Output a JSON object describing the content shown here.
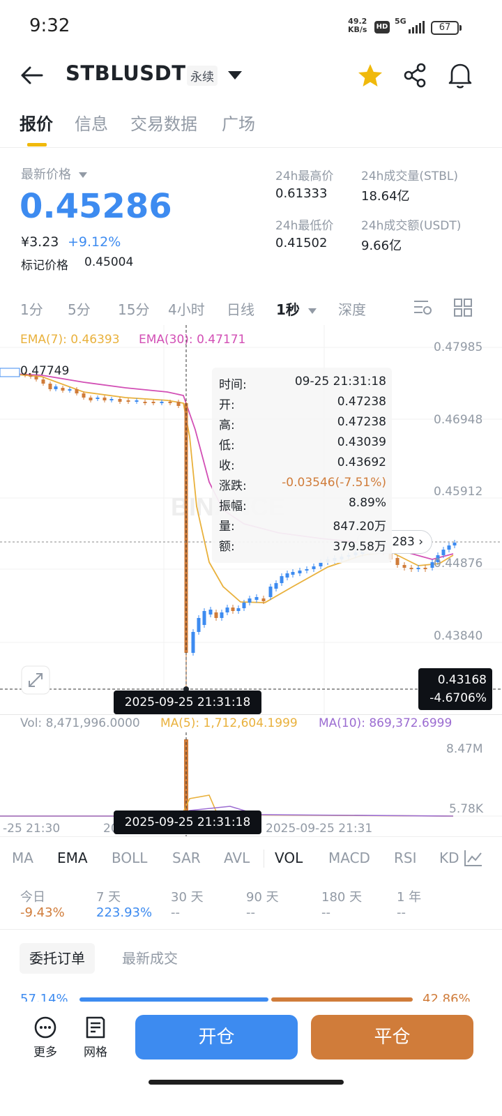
{
  "status_bar": {
    "time": "9:32",
    "speed_value": "49.2",
    "speed_unit": "KB/s",
    "hd": "HD",
    "network": "5G",
    "battery": "67"
  },
  "header": {
    "symbol": "STBLUSDT",
    "badge": "永续",
    "icons": [
      "back-arrow-icon",
      "dropdown-caret-icon",
      "star-icon",
      "share-icon",
      "bell-icon"
    ],
    "star_color": "#f0b90b"
  },
  "tabs": [
    "报价",
    "信息",
    "交易数据",
    "广场"
  ],
  "price": {
    "label": "最新价格",
    "last": "0.45286",
    "cny": "¥3.23",
    "change_pct": "+9.12%",
    "mark_label": "标记价格",
    "mark_value": "0.45004"
  },
  "stats": [
    {
      "label": "24h最高价",
      "value": "0.61333"
    },
    {
      "label": "24h成交量(STBL)",
      "value": "18.64亿"
    },
    {
      "label": "24h最低价",
      "value": "0.41502"
    },
    {
      "label": "24h成交额(USDT)",
      "value": "9.66亿"
    }
  ],
  "intervals": [
    "1分",
    "5分",
    "15分",
    "4小时",
    "日线",
    "1秒",
    "深度"
  ],
  "active_interval": "1秒",
  "chart": {
    "ema7": "EMA(7): 0.46393",
    "ema30": "EMA(30): 0.47171",
    "y_labels": [
      "0.47985",
      "0.46948",
      "0.45912",
      "0.44876",
      "0.43840"
    ],
    "first_price_label": "0.47749",
    "last_price_pill": "283",
    "cross_price": "0.43168",
    "cross_pct": "-4.6706%",
    "cross_time": "2025-09-25 21:31:18",
    "watermark": "BINANCE",
    "colors": {
      "up": "#3d8bf0",
      "down": "#d07c3a",
      "ema7": "#e9b13c",
      "ema30": "#d24fb5",
      "ma10": "#9b6cd1"
    }
  },
  "tooltip": {
    "rows": [
      {
        "k": "时间:",
        "v": "09-25 21:31:18"
      },
      {
        "k": "开:",
        "v": "0.47238"
      },
      {
        "k": "高:",
        "v": "0.47238"
      },
      {
        "k": "低:",
        "v": "0.43039"
      },
      {
        "k": "收:",
        "v": "0.43692"
      },
      {
        "k": "涨跌:",
        "v": "-0.03546(-7.51%)"
      },
      {
        "k": "振幅:",
        "v": "8.89%"
      },
      {
        "k": "量:",
        "v": "847.20万"
      },
      {
        "k": "额:",
        "v": "379.58万"
      }
    ]
  },
  "volume": {
    "vol": "Vol: 8,471,996.0000",
    "ma5": "MA(5): 1,712,604.1999",
    "ma10": "MA(10): 869,372.6999",
    "y_labels": [
      "8.47M",
      "5.78K"
    ],
    "x_labels": [
      "-25 21:30",
      "20",
      "2025-09-25 21:31"
    ]
  },
  "indicators": [
    "MA",
    "EMA",
    "BOLL",
    "SAR",
    "AVL",
    "VOL",
    "MACD",
    "RSI",
    "KD"
  ],
  "performance": [
    {
      "label": "今日",
      "value": "-9.43%",
      "color": "#d07c3a"
    },
    {
      "label": "7 天",
      "value": "223.93%",
      "color": "#3d8bf0"
    },
    {
      "label": "30 天",
      "value": "--"
    },
    {
      "label": "90 天",
      "value": "--"
    },
    {
      "label": "180 天",
      "value": "--"
    },
    {
      "label": "1 年",
      "value": "--"
    }
  ],
  "orders": {
    "tabs": [
      "委托订单",
      "最新成交"
    ],
    "buy_pct": "57.14%",
    "sell_pct": "42.86%"
  },
  "bottom": {
    "more": "更多",
    "grid": "网格",
    "open": "开仓",
    "close": "平仓"
  }
}
